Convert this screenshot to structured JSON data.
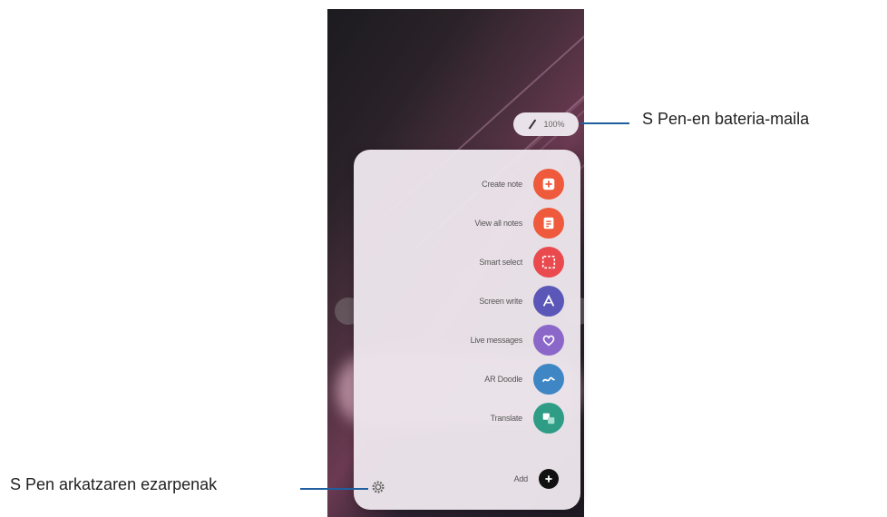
{
  "callouts": {
    "battery": "S Pen-en bateria-maila",
    "settings": "S Pen arkatzaren ezarpenak"
  },
  "battery": {
    "value": "100%"
  },
  "menu": {
    "items": [
      {
        "label": "Create note",
        "icon": "create-note-icon",
        "color": "#ee5a3b"
      },
      {
        "label": "View all notes",
        "icon": "notes-icon",
        "color": "#ee5a3b"
      },
      {
        "label": "Smart select",
        "icon": "smart-select-icon",
        "color": "#ea4a4e"
      },
      {
        "label": "Screen write",
        "icon": "screen-write-icon",
        "color": "#5a57b8"
      },
      {
        "label": "Live messages",
        "icon": "heart-icon",
        "color": "#8b67c9"
      },
      {
        "label": "AR Doodle",
        "icon": "ar-doodle-icon",
        "color": "#3f86c4"
      },
      {
        "label": "Translate",
        "icon": "translate-icon",
        "color": "#2f9c86"
      }
    ],
    "add_label": "Add"
  },
  "colors": {
    "leader": "#1f5fa0",
    "panel": "#ece5eb"
  }
}
